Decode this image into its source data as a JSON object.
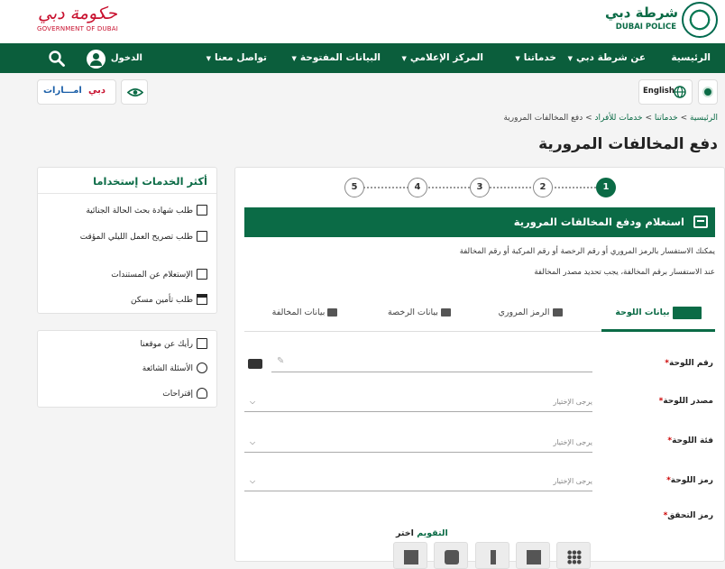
{
  "header": {
    "police_ar": "شرطة دبي",
    "police_en": "DUBAI POLICE",
    "gov_ar": "حكومة دبي",
    "gov_en": "GOVERNMENT OF DUBAI"
  },
  "nav": {
    "items": [
      {
        "label": "الرئيسية",
        "dropdown": false
      },
      {
        "label": "عن شرطة دبي",
        "dropdown": true
      },
      {
        "label": "خدماتنا",
        "dropdown": true
      },
      {
        "label": "المركز الإعلامي",
        "dropdown": true
      },
      {
        "label": "البيانات المفتوحة",
        "dropdown": true
      },
      {
        "label": "تواصل معنا",
        "dropdown": true
      }
    ],
    "login": "الدخول"
  },
  "tools": {
    "language": "English",
    "dubai_ar": "دبي",
    "emarat": "امـــارات"
  },
  "breadcrumb": {
    "home": "الرئيسية",
    "services": "خدماتنا",
    "individuals": "خدمات للأفراد",
    "current": "دفع المخالفات المرورية",
    "sep": ">"
  },
  "page_title": "دفع المخالفات المرورية",
  "steps": [
    "1",
    "2",
    "3",
    "4",
    "5"
  ],
  "banner": "استعلام ودفع المخالفات المرورية",
  "info": {
    "line1": "يمكنك الاستفسار بالرمز المروري أو رقم الرخصة أو رقم المركبة أو رقم المخالفة",
    "line2": "عند الاستفسار برقم المخالفة، يجب تحديد مصدر المخالفة"
  },
  "tabs": [
    {
      "label": "بيانات اللوحة",
      "active": true
    },
    {
      "label": "الرمز المروري",
      "active": false
    },
    {
      "label": "بيانات الرخصة",
      "active": false
    },
    {
      "label": "بيانات المخالفة",
      "active": false
    }
  ],
  "form": {
    "plate_number": "رقم اللوحة",
    "plate_source": "مصدر اللوحة",
    "plate_category": "فئة اللوحة",
    "plate_code": "رمز اللوحة",
    "captcha": "رمز التحقق",
    "required": "*",
    "select_placeholder": "يرجى الإختيار",
    "captcha_prefix": "اختر",
    "captcha_word": "التقويم"
  },
  "sidebar": {
    "top_title": "أكثر الخدمات إستخداما",
    "top_items": [
      {
        "label": "طلب شهادة بحث الحالة الجنائية"
      },
      {
        "label": "طلب تصريح العمل الليلي المؤقت"
      },
      {
        "label": "الإستعلام عن المستندات"
      },
      {
        "label": "طلب تأمين مسكن"
      }
    ],
    "bottom_items": [
      {
        "label": "رأيك عن موقعنا"
      },
      {
        "label": "الأسئلة الشائعة"
      },
      {
        "label": "إقتراحات"
      }
    ]
  },
  "colors": {
    "brand": "#0b6b46",
    "nav": "#0b5e3c",
    "gov": "#c8102e"
  }
}
